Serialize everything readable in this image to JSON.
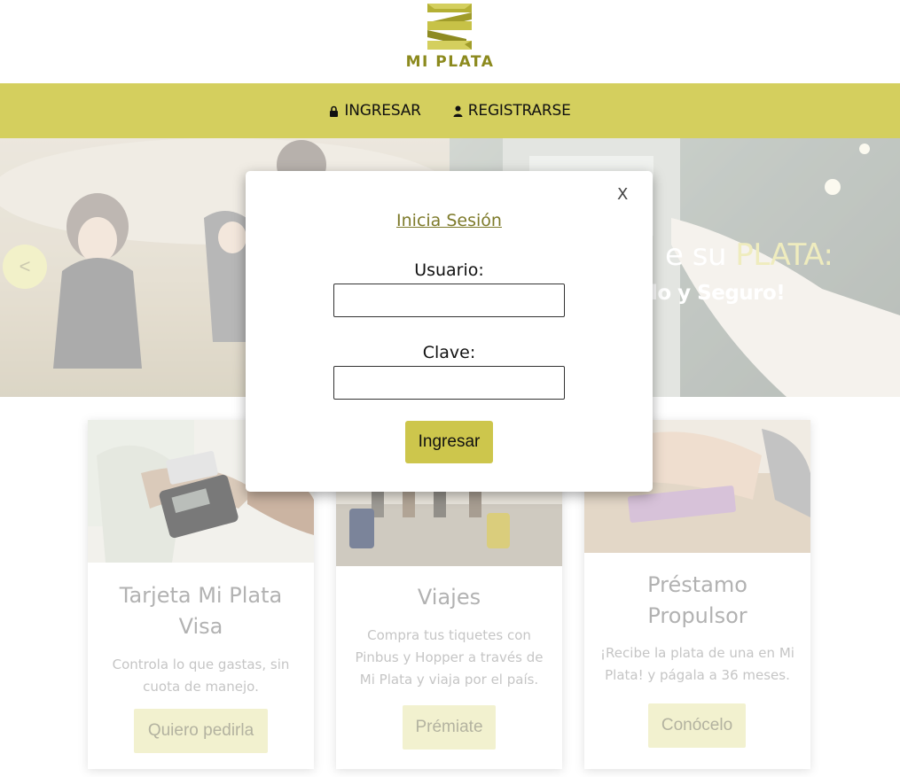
{
  "brand": {
    "name": "MI PLATA",
    "color": "#8c8a1e"
  },
  "colors": {
    "nav_bg": "#d4cf5e",
    "button": "#cdc64c",
    "card_button": "#ecebb9"
  },
  "nav": {
    "items": [
      {
        "label": "INGRESAR",
        "icon": "lock-icon"
      },
      {
        "label": "REGISTRARSE",
        "icon": "user-icon"
      }
    ]
  },
  "hero": {
    "headline_prefix": "e su",
    "headline_accent": "PLATA:",
    "subline": "ido y Seguro!",
    "prev_arrow": "<"
  },
  "cards": [
    {
      "title_line1": "Tarjeta Mi Plata",
      "title_line2": "Visa",
      "text_line1": "Controla lo que gastas, sin",
      "text_line2": "cuota de manejo.",
      "button": "Quiero pedirla"
    },
    {
      "title_line1": "Viajes",
      "text_line1": "Compra tus tiquetes con",
      "text_line2": "Pinbus y Hopper a través de",
      "text_line3": "Mi Plata y viaja por el país.",
      "button": "Prémiate"
    },
    {
      "title_line1": "Préstamo",
      "title_line2": "Propulsor",
      "text_line1": "¡Recibe la plata de una en Mi",
      "text_line2": "Plata! y págala a 36 meses.",
      "button": "Conócelo"
    }
  ],
  "modal": {
    "close": "X",
    "title": "Inicia Sesión",
    "username_label": "Usuario:",
    "username_value": "",
    "password_label": "Clave:",
    "password_value": "",
    "submit": "Ingresar"
  }
}
